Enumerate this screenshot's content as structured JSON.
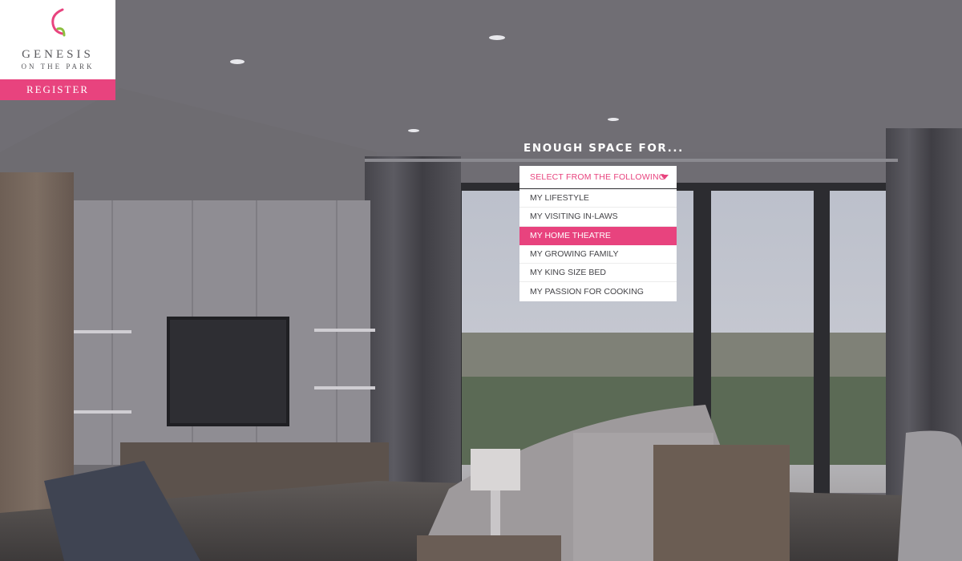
{
  "brand": {
    "name": "GENESIS",
    "tagline": "ON THE PARK",
    "accent_color": "#e8437e",
    "logo_icon": "genesis-swirl-icon"
  },
  "nav": {
    "register_label": "REGISTER"
  },
  "hero": {
    "heading": "ENOUGH SPACE FOR...",
    "select": {
      "value": "SELECT FROM THE FOLLOWING",
      "caret_icon": "caret-down-icon",
      "options": [
        "MY LIFESTYLE",
        "MY VISITING IN-LAWS",
        "MY HOME THEATRE",
        "MY GROWING FAMILY",
        "MY KING SIZE BED",
        "MY PASSION FOR COOKING"
      ],
      "highlighted_index": 2
    }
  }
}
